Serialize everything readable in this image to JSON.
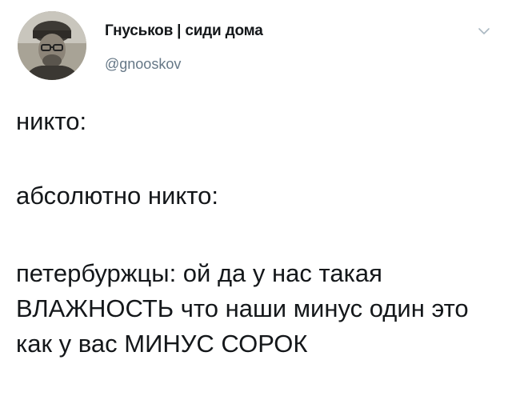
{
  "author": {
    "display_name": "Гнуськов | сиди дома",
    "username": "@gnooskov",
    "avatar": "avatar-photo",
    "menu_icon": "chevron-down-icon"
  },
  "tweet": {
    "line_1": "никто:",
    "line_2": "абсолютно никто:",
    "line_3": "петербуржцы: ой да у нас такая ВЛАЖНОСТЬ что наши минус один это как у вас МИНУС СОРОК"
  },
  "colors": {
    "text": "#14171a",
    "secondary": "#657786",
    "caret": "#aab8c2"
  }
}
